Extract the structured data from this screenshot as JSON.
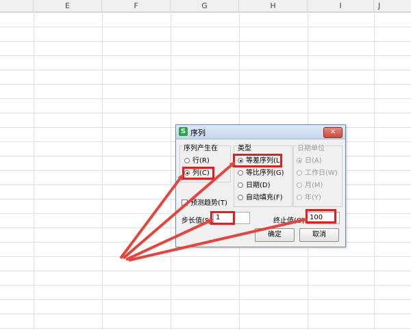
{
  "spreadsheet": {
    "columns": [
      "E",
      "F",
      "G",
      "H",
      "I",
      "J"
    ]
  },
  "dialog": {
    "icon_glyph": "S",
    "title": "序列",
    "close_glyph": "✕",
    "group_series_in": {
      "label": "序列产生在",
      "options": [
        {
          "label": "行(R)",
          "checked": false
        },
        {
          "label": "列(C)",
          "checked": true
        }
      ]
    },
    "group_type": {
      "label": "类型",
      "options": [
        {
          "label": "等差序列(L)",
          "checked": true
        },
        {
          "label": "等比序列(G)",
          "checked": false
        },
        {
          "label": "日期(D)",
          "checked": false
        },
        {
          "label": "自动填充(F)",
          "checked": false
        }
      ]
    },
    "group_date_unit": {
      "label": "日期单位",
      "disabled": true,
      "options": [
        {
          "label": "日(A)",
          "checked": true
        },
        {
          "label": "工作日(W)",
          "checked": false
        },
        {
          "label": "月(M)",
          "checked": false
        },
        {
          "label": "年(Y)",
          "checked": false
        }
      ]
    },
    "trend_checkbox_label": "预测趋势(T)",
    "step": {
      "label": "步长值(S):",
      "value": "1"
    },
    "stop": {
      "label": "终止值(O):",
      "value": "100"
    },
    "ok_label": "确定",
    "cancel_label": "取消"
  },
  "annotation": {
    "highlight_color": "#e02020",
    "arrow_color": "#e8433a"
  }
}
